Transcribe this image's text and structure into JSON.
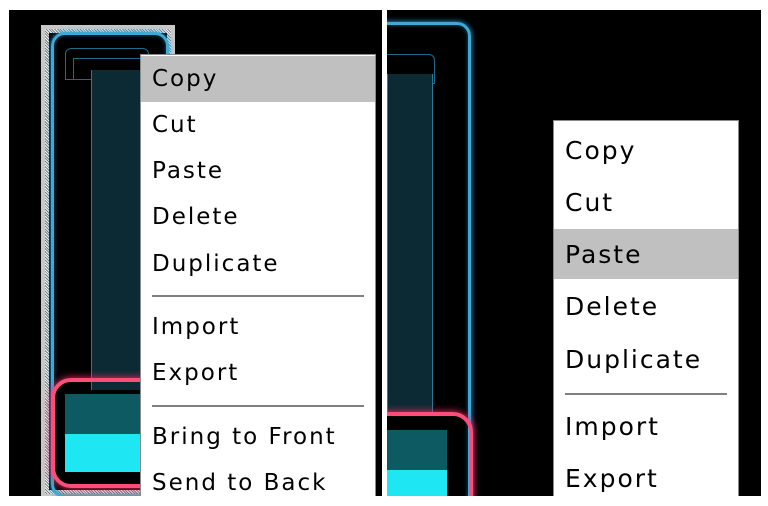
{
  "left_panel": {
    "menu": {
      "items": [
        {
          "label": "Copy",
          "highlighted": true
        },
        {
          "label": "Cut",
          "highlighted": false
        },
        {
          "label": "Paste",
          "highlighted": false
        },
        {
          "label": "Delete",
          "highlighted": false
        },
        {
          "label": "Duplicate",
          "highlighted": false
        },
        {
          "label": "Import",
          "highlighted": false
        },
        {
          "label": "Export",
          "highlighted": false
        },
        {
          "label": "Bring to Front",
          "highlighted": false
        },
        {
          "label": "Send to Back",
          "highlighted": false
        }
      ]
    }
  },
  "right_panel": {
    "menu": {
      "items": [
        {
          "label": "Copy",
          "highlighted": false
        },
        {
          "label": "Cut",
          "highlighted": false
        },
        {
          "label": "Paste",
          "highlighted": true
        },
        {
          "label": "Delete",
          "highlighted": false
        },
        {
          "label": "Duplicate",
          "highlighted": false
        },
        {
          "label": "Import",
          "highlighted": false
        },
        {
          "label": "Export",
          "highlighted": false
        }
      ]
    }
  },
  "colors": {
    "background": "#000000",
    "fader_outline": "#3fa8d6",
    "knob_outline": "#ff4d7a",
    "knob_fill": "#1ee6f2",
    "menu_highlight": "#c0c0c0"
  }
}
